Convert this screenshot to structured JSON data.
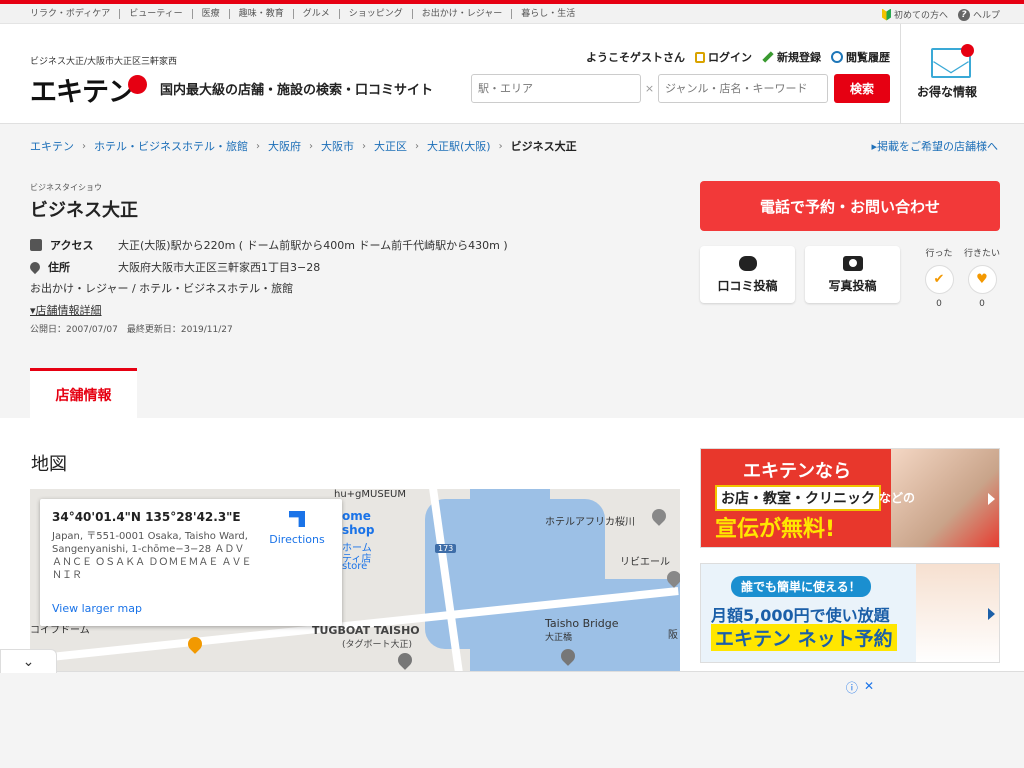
{
  "util": {
    "categories": [
      "リラク・ボディケア",
      "ビューティー",
      "医療",
      "趣味・教育",
      "グルメ",
      "ショッピング",
      "お出かけ・レジャー",
      "暮らし・生活"
    ],
    "beginner": "初めての方へ",
    "help": "ヘルプ"
  },
  "header": {
    "location": "ビジネス大正/大阪市大正区三軒家西",
    "logo": "エキテン",
    "tagline": "国内最大級の店舗・施設の検索・口コミサイト",
    "welcome": "ようこそゲストさん",
    "login": "ログイン",
    "register": "新規登録",
    "history": "閲覧履歴",
    "search_area_placeholder": "駅・エリア",
    "search_keyword_placeholder": "ジャンル・店名・キーワード",
    "search_button": "検索",
    "deals_label": "お得な情報"
  },
  "breadcrumb": [
    "エキテン",
    "ホテル・ビジネスホテル・旅館",
    "大阪府",
    "大阪市",
    "大正区",
    "大正駅(大阪)",
    "ビジネス大正"
  ],
  "listing_link": "掲載をご希望の店舗様へ",
  "shop": {
    "kana": "ビジネスタイショウ",
    "name": "ビジネス大正",
    "access_label": "アクセス",
    "access": "大正(大阪)駅から220m ( ドーム前駅から400m ドーム前千代崎駅から430m )",
    "address_label": "住所",
    "address": "大阪府大阪市大正区三軒家西1丁目3−28",
    "categories": "お出かけ・レジャー /  ホテル・ビジネスホテル・旅館",
    "detail_link": "店舗情報詳細",
    "dates": "公開日：2007/07/07　最終更新日：2019/11/27"
  },
  "actions": {
    "call": "電話で予約・お問い合わせ",
    "review": "口コミ投稿",
    "photo": "写真投稿",
    "went_label": "行った",
    "went_count": "0",
    "want_label": "行きたい",
    "want_count": "0"
  },
  "tabs": {
    "store_info": "店舗情報"
  },
  "map_section": {
    "title": "地図",
    "coords": "34°40'01.4\"N 135°28'42.3\"E",
    "address": "Japan, 〒551-0001 Osaka, Taisho Ward, Sangenyanishi, 1-chōme−3−28 ＡＤＶＡＮＣＥ ＯＳＡＫＡ ＤＯＭＥＭＡＥ ＡＶＥＮＩＲ",
    "directions": "Directions",
    "larger_map": "View larger map",
    "labels": {
      "museum": "hu+gMUSEUM",
      "shop_a": "ome",
      "shop_b": "shop",
      "shop_c": "ホーム",
      "shop_d": "ティ店",
      "shop_e": "store",
      "route": "173",
      "hotel": "ホテルアフリカ桜川",
      "rib": "リビエール",
      "tugboat": "TUGBOAT TAISHO",
      "tugboat_jp": "(タグボート大正)",
      "bridge": "Taisho Bridge",
      "bridge_jp": "大正橋",
      "dome": "コイフドーム",
      "han": "阪"
    }
  },
  "banners": {
    "b1_line1": "エキテンなら",
    "b1_line2": "お店・教室・クリニック",
    "b1_line2b": "などの",
    "b1_line3": "宣伝が無料!",
    "b2_line1": "誰でも簡単に使える！",
    "b2_line2": "月額5,000円で使い放題",
    "b2_line3": "エキテン ネット予約"
  },
  "colors": {
    "brand": "#e60012",
    "link": "#1d6fb8",
    "call": "#f23939"
  }
}
